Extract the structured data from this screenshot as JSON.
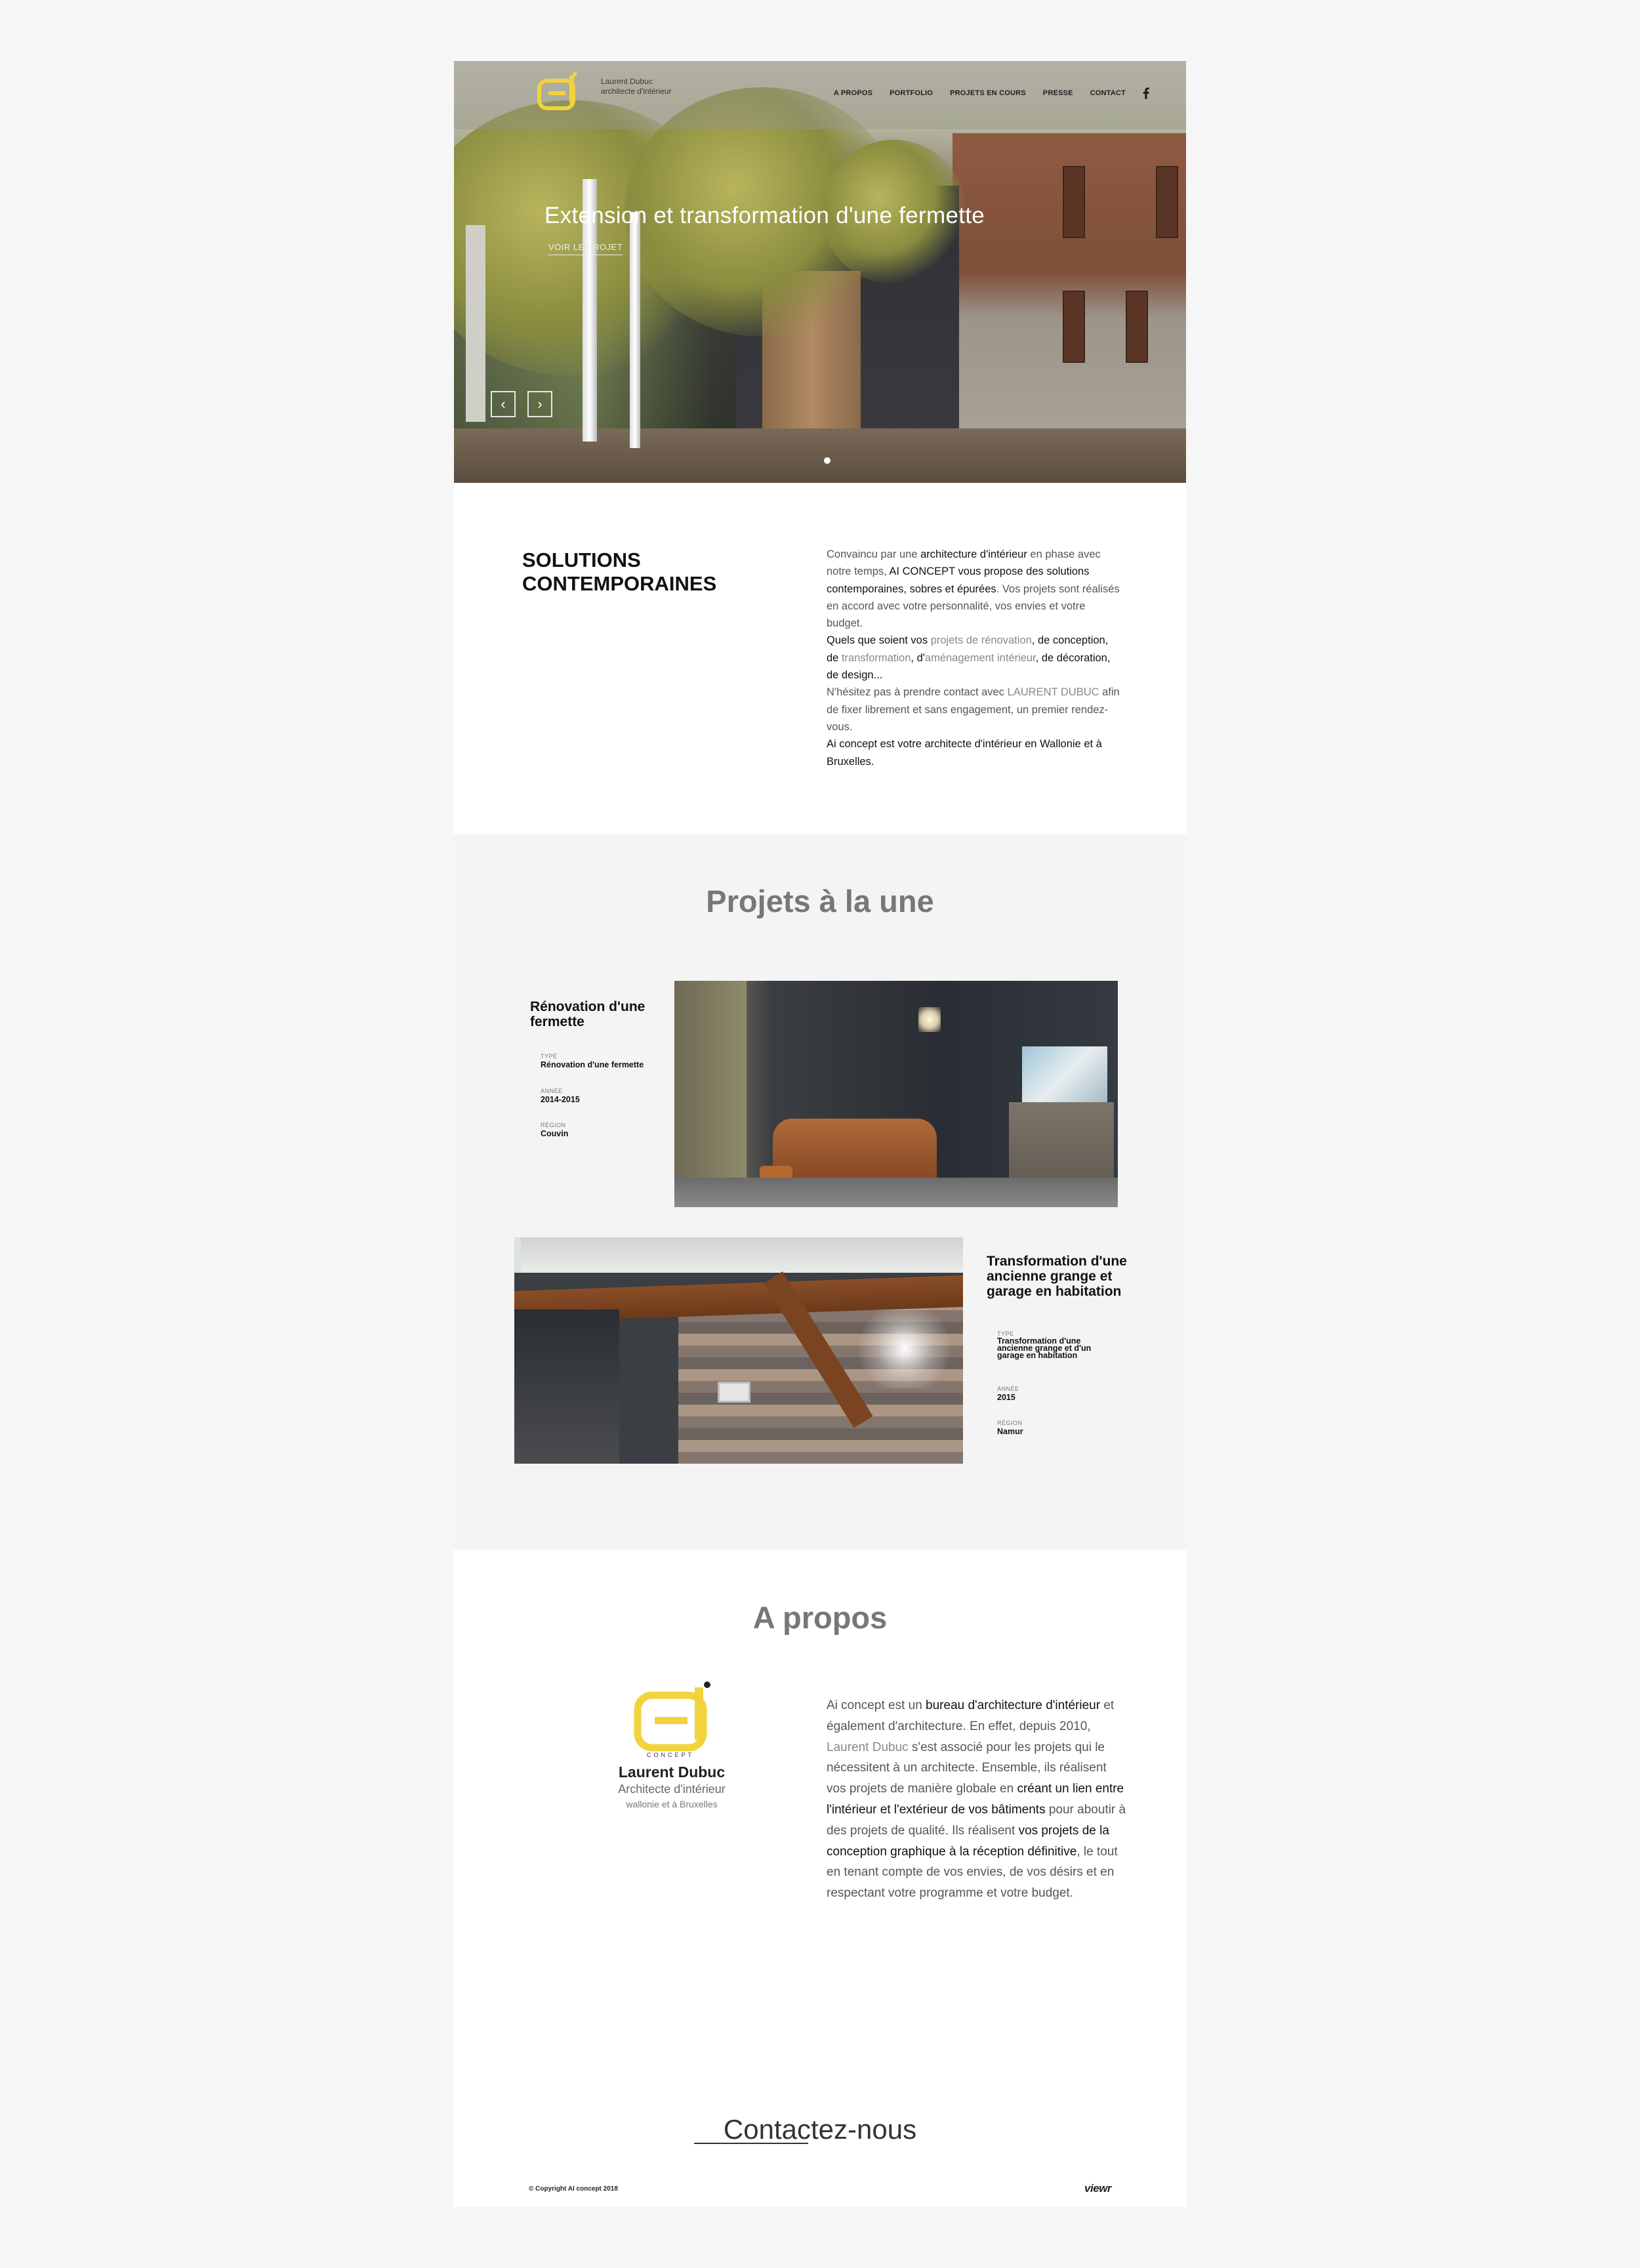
{
  "header": {
    "logo_line1": "Laurent Dubuc",
    "logo_line2": "architecte d'intérieur",
    "nav": [
      "A PROPOS",
      "PORTFOLIO",
      "PROJETS EN COURS",
      "PRESSE",
      "CONTACT"
    ],
    "social_icon": "facebook-icon"
  },
  "hero": {
    "title": "Extension et transformation d'une fermette",
    "link": "VOIR LE PROJET",
    "prev_glyph": "‹",
    "next_glyph": "›"
  },
  "solutions": {
    "title_line1": "SOLUTIONS",
    "title_line2": "CONTEMPORAINES",
    "p": [
      "Convaincu par une ",
      "architecture d'intérieur",
      " en phase avec notre temps, ",
      "AI CONCEPT vous propose des solutions contemporaines, sobres et épurées",
      ". Vos projets sont réalisés en accord avec votre personnalité, vos envies et votre budget.",
      "Quels que soient ",
      "vos ",
      "projets de rénovation",
      ", de conception, de ",
      "transformation",
      ", d'",
      "aménagement intérieur",
      ", de décoration, de design...",
      "N'hésitez pas à prendre contact avec ",
      "LAURENT DUBUC",
      " afin de fixer librement et sans engagement, un premier rendez-vous.",
      "Ai concept est votre architecte d'intérieur en Wallonie et à Bruxelles."
    ]
  },
  "projects": {
    "title": "Projets à la une",
    "items": [
      {
        "name": "Rénovation d'une fermette",
        "type_label": "TYPE",
        "type": "Rénovation d'une fermette",
        "year_label": "ANNÉE",
        "year": "2014-2015",
        "region_label": "RÉGION",
        "region": "Couvin"
      },
      {
        "name": "Transformation d'une ancienne grange et garage en habitation",
        "type_label": "TYPE",
        "type": "Transformation d'une ancienne grange et d'un garage en habitation",
        "year_label": "ANNÉE",
        "year": "2015",
        "region_label": "RÉGION",
        "region": "Namur"
      }
    ]
  },
  "apropos": {
    "title": "A propos",
    "logo_caption": "CONCEPT",
    "name": "Laurent Dubuc",
    "role": "Architecte d'intérieur",
    "region": "wallonie et à Bruxelles",
    "p": [
      "Ai concept est un ",
      "bureau d'architecture d'intérieur",
      " et également d'architecture. En effet, depuis 2010, ",
      "Laurent Dubuc",
      " s'est associé pour les projets qui le nécessitent à un architecte. Ensemble, ils réalisent vos projets de manière globale en ",
      "créant un lien entre l'intérieur et l'extérieur de vos bâtiments",
      " pour aboutir à des projets de qualité. Ils réalisent ",
      "vos projets de la conception graphique à la réception définitive",
      ", le tout en tenant compte de vos envies, de vos désirs et en respectant votre programme et votre budget."
    ]
  },
  "footer": {
    "contact": "Contactez-nous",
    "copyright": "© Copyright AI concept 2018",
    "credit": "viewr"
  },
  "colors": {
    "accent": "#f2d33c",
    "title_gray": "#777777"
  }
}
